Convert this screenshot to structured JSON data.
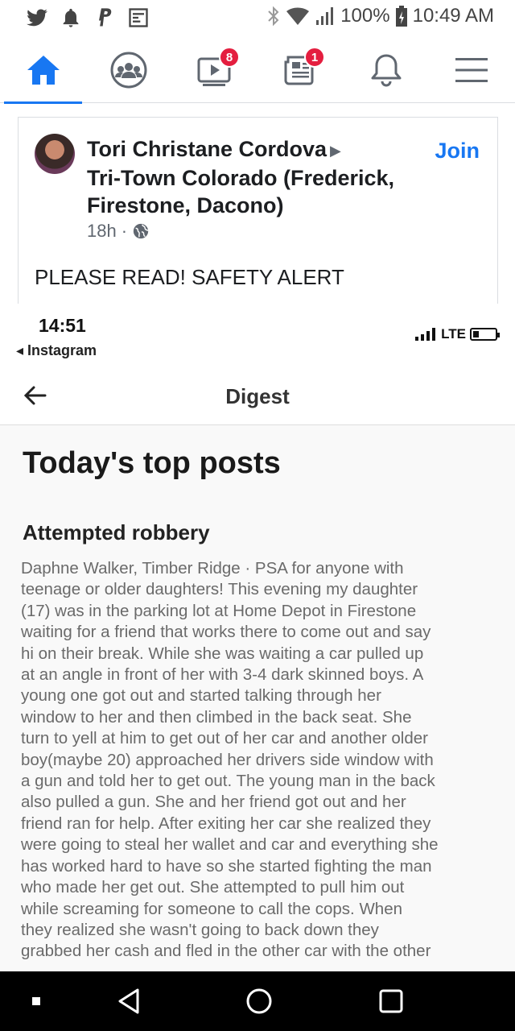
{
  "status_bar": {
    "left_icons": [
      "twitter-icon",
      "notification-bell-icon",
      "paypal-icon",
      "sim-card-icon"
    ],
    "right_icons": [
      "bluetooth-icon",
      "wifi-icon",
      "signal-icon",
      "battery-icon"
    ],
    "battery": "100%",
    "time": "10:49 AM"
  },
  "fb_nav": {
    "items": [
      {
        "name": "home",
        "icon": "home-icon",
        "active": true
      },
      {
        "name": "groups",
        "icon": "groups-icon"
      },
      {
        "name": "watch",
        "icon": "video-icon",
        "badge": "8"
      },
      {
        "name": "news",
        "icon": "newspaper-icon",
        "badge": "1"
      },
      {
        "name": "notifications",
        "icon": "bell-icon"
      },
      {
        "name": "menu",
        "icon": "hamburger-icon"
      }
    ],
    "accent": "#1877f2"
  },
  "post": {
    "author": "Tori Christane Cordova",
    "group": "Tri-Town Colorado (Frederick, Firestone, Dacono)",
    "join_label": "Join",
    "time": "18h",
    "privacy_icon": "globe-icon",
    "text": "PLEASE READ! SAFETY ALERT"
  },
  "embedded": {
    "time": "14:51",
    "back_app": "◂ Instagram",
    "network": "LTE",
    "header_title": "Digest",
    "heading": "Today's top posts",
    "post_title": "Attempted robbery",
    "lines": [
      "Daphne Walker, Timber Ridge · PSA for anyone with",
      "teenage or older daughters! This evening my daughter",
      "(17) was in the parking lot at Home Depot in Firestone",
      "waiting for a friend that works there to come out and say",
      "hi on their break. While she was waiting a car pulled up",
      "at an angle in front of her with 3-4 dark skinned boys. A",
      "young one got out and started talking through her",
      "window to her and then climbed in the back seat. She",
      "turn to yell at him to get out of her car and another older",
      "boy(maybe 20) approached her drivers side window with",
      "a gun and told her to get out. The young man in the back",
      "also pulled a gun. She and her friend got out and her",
      "friend ran for help. After exiting her car she realized they",
      "were going to steal her wallet and car and everything she",
      "has worked hard to have so she started fighting the man",
      "who made her get out. She attempted to pull him out",
      "while screaming for someone to call the cops. When",
      "they realized she wasn't going to back down they",
      "grabbed her cash and fled in the other car with the other"
    ]
  },
  "android_nav": [
    "recents-dot-icon",
    "back-triangle-icon",
    "home-circle-icon",
    "overview-square-icon"
  ]
}
